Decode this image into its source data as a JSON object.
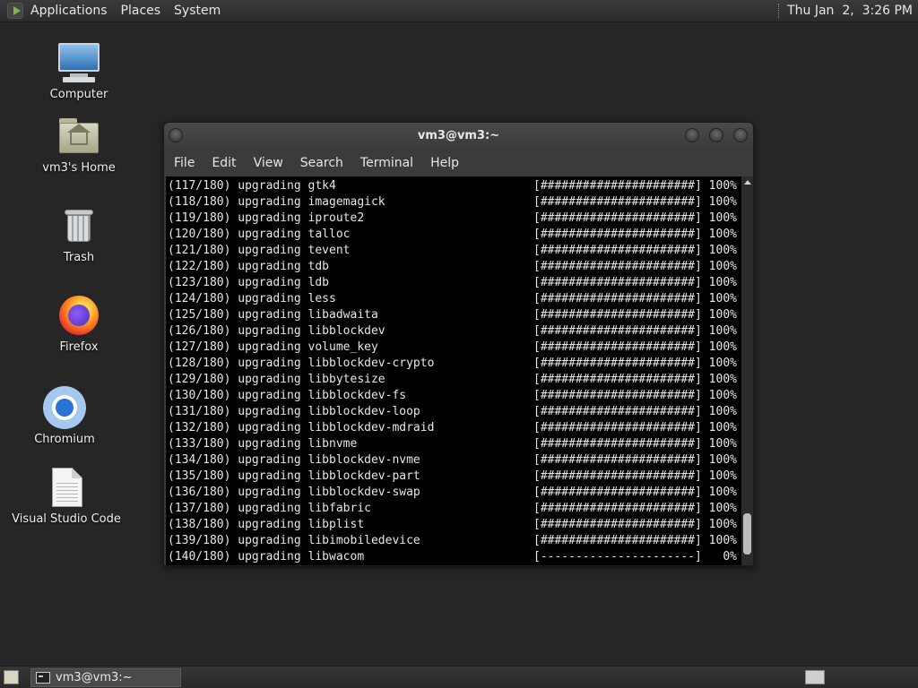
{
  "top_panel": {
    "menus": [
      "Applications",
      "Places",
      "System"
    ],
    "clock": "Thu Jan  2,  3:26 PM"
  },
  "desktop_icons": [
    {
      "label": "Computer",
      "icon": "computer-icon"
    },
    {
      "label": "vm3's Home",
      "icon": "home-folder-icon"
    },
    {
      "label": "Trash",
      "icon": "trash-icon"
    },
    {
      "label": "Firefox",
      "icon": "firefox-icon"
    },
    {
      "label": "Chromium",
      "icon": "chromium-icon"
    },
    {
      "label": "Visual Studio Code",
      "icon": "document-icon"
    }
  ],
  "terminal": {
    "title": "vm3@vm3:~",
    "menus": [
      "File",
      "Edit",
      "View",
      "Search",
      "Terminal",
      "Help"
    ],
    "lines": [
      {
        "text": "(117/180) upgrading gtk4",
        "progress": "[######################] 100%"
      },
      {
        "text": "(118/180) upgrading imagemagick",
        "progress": "[######################] 100%"
      },
      {
        "text": "(119/180) upgrading iproute2",
        "progress": "[######################] 100%"
      },
      {
        "text": "(120/180) upgrading talloc",
        "progress": "[######################] 100%"
      },
      {
        "text": "(121/180) upgrading tevent",
        "progress": "[######################] 100%"
      },
      {
        "text": "(122/180) upgrading tdb",
        "progress": "[######################] 100%"
      },
      {
        "text": "(123/180) upgrading ldb",
        "progress": "[######################] 100%"
      },
      {
        "text": "(124/180) upgrading less",
        "progress": "[######################] 100%"
      },
      {
        "text": "(125/180) upgrading libadwaita",
        "progress": "[######################] 100%"
      },
      {
        "text": "(126/180) upgrading libblockdev",
        "progress": "[######################] 100%"
      },
      {
        "text": "(127/180) upgrading volume_key",
        "progress": "[######################] 100%"
      },
      {
        "text": "(128/180) upgrading libblockdev-crypto",
        "progress": "[######################] 100%"
      },
      {
        "text": "(129/180) upgrading libbytesize",
        "progress": "[######################] 100%"
      },
      {
        "text": "(130/180) upgrading libblockdev-fs",
        "progress": "[######################] 100%"
      },
      {
        "text": "(131/180) upgrading libblockdev-loop",
        "progress": "[######################] 100%"
      },
      {
        "text": "(132/180) upgrading libblockdev-mdraid",
        "progress": "[######################] 100%"
      },
      {
        "text": "(133/180) upgrading libnvme",
        "progress": "[######################] 100%"
      },
      {
        "text": "(134/180) upgrading libblockdev-nvme",
        "progress": "[######################] 100%"
      },
      {
        "text": "(135/180) upgrading libblockdev-part",
        "progress": "[######################] 100%"
      },
      {
        "text": "(136/180) upgrading libblockdev-swap",
        "progress": "[######################] 100%"
      },
      {
        "text": "(137/180) upgrading libfabric",
        "progress": "[######################] 100%"
      },
      {
        "text": "(138/180) upgrading libplist",
        "progress": "[######################] 100%"
      },
      {
        "text": "(139/180) upgrading libimobiledevice",
        "progress": "[######################] 100%"
      },
      {
        "text": "(140/180) upgrading libwacom",
        "progress": "[----------------------]   0%"
      }
    ]
  },
  "taskbar": {
    "window_button": "vm3@vm3:~"
  }
}
